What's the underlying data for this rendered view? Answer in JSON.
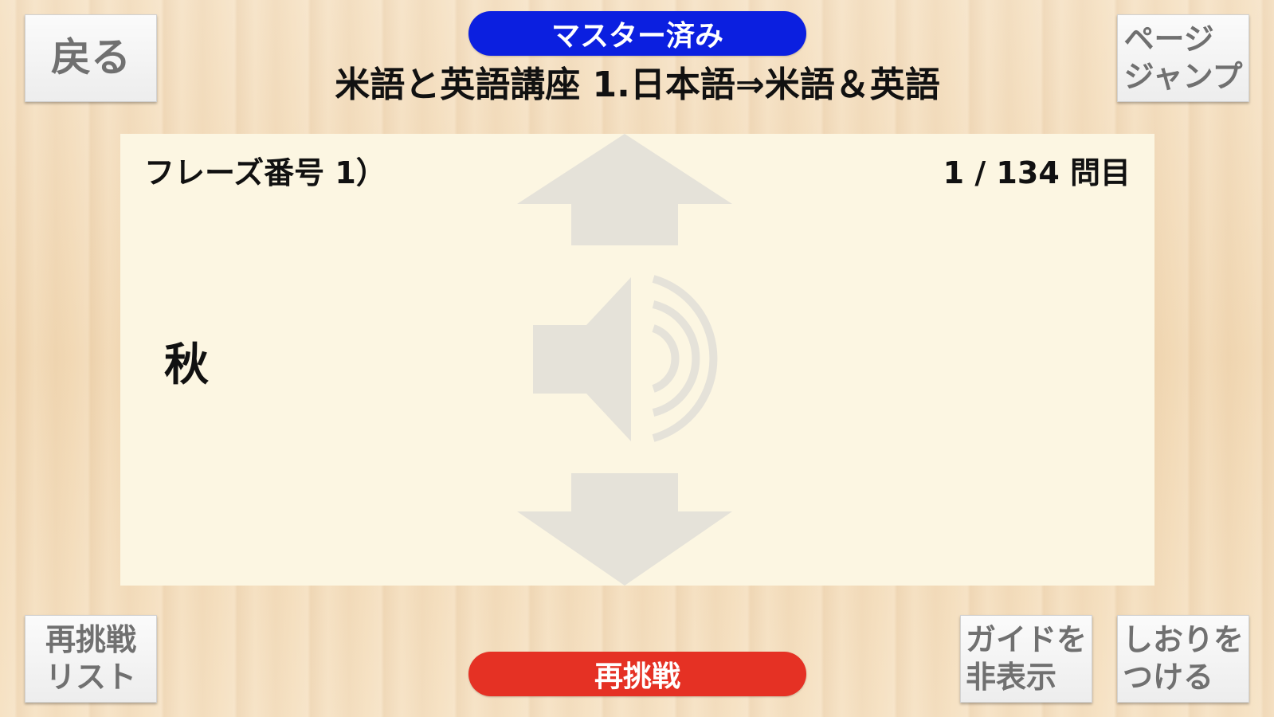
{
  "header": {
    "back_label": "戻る",
    "mastered_label": "マスター済み",
    "title": "米語と英語講座 1.日本語⇒米語＆英語",
    "page_jump_label": "ページ\nジャンプ"
  },
  "card": {
    "phrase_number": "フレーズ番号 1）",
    "counter": "1 / 134 問目",
    "prompt": "秋",
    "icons": [
      "arrow-up-icon",
      "speaker-icon",
      "arrow-down-icon"
    ]
  },
  "footer": {
    "retry_list_label": "再挑戦\nリスト",
    "retry_label": "再挑戦",
    "guide_label": "ガイドを\n非表示",
    "bookmark_label": "しおりを\nつける"
  },
  "colors": {
    "mastered": "#0b1fe0",
    "retry": "#e53124",
    "card_bg": "#fcf6e2",
    "icon_gray": "#e5e2d9"
  }
}
